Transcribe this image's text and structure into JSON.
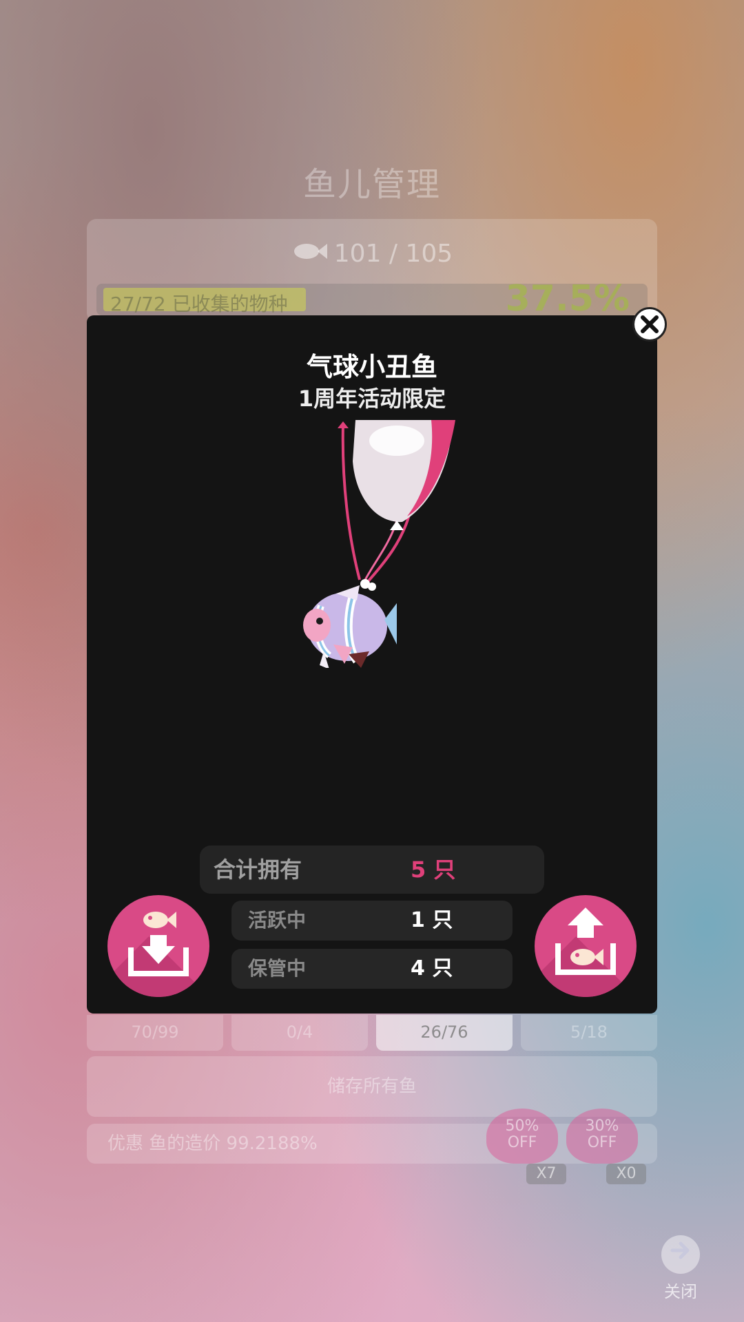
{
  "background": {
    "title": "鱼儿管理",
    "fish_count": "101 / 105",
    "collection": "27/72 已收集的物种",
    "collection_percent": "37.5%",
    "collection_progress": 0.375,
    "tabs": [
      {
        "label": "70/99"
      },
      {
        "label": "0/4"
      },
      {
        "label": "26/76"
      },
      {
        "label": "5/18"
      }
    ],
    "store_all_label": "储存所有鱼",
    "discount_text": "优惠 鱼的造价 99.2188%",
    "coupons": [
      {
        "label": "50%\nOFF",
        "count": "X7"
      },
      {
        "label": "30%\nOFF",
        "count": "X0"
      }
    ],
    "close_label": "关闭"
  },
  "modal": {
    "title": "气球小丑鱼",
    "subtitle": "1周年活动限定",
    "total_label": "合计拥有",
    "total_value": "5 只",
    "active_label": "活跃中",
    "active_value": "1 只",
    "stored_label": "保管中",
    "stored_value": "4 只"
  },
  "colors": {
    "accent_pink": "#d94a86",
    "total_value": "#e0407a",
    "modal_bg": "#141414"
  },
  "icons": {
    "close": "close-icon",
    "store": "store-fish-icon",
    "release": "release-fish-icon"
  }
}
